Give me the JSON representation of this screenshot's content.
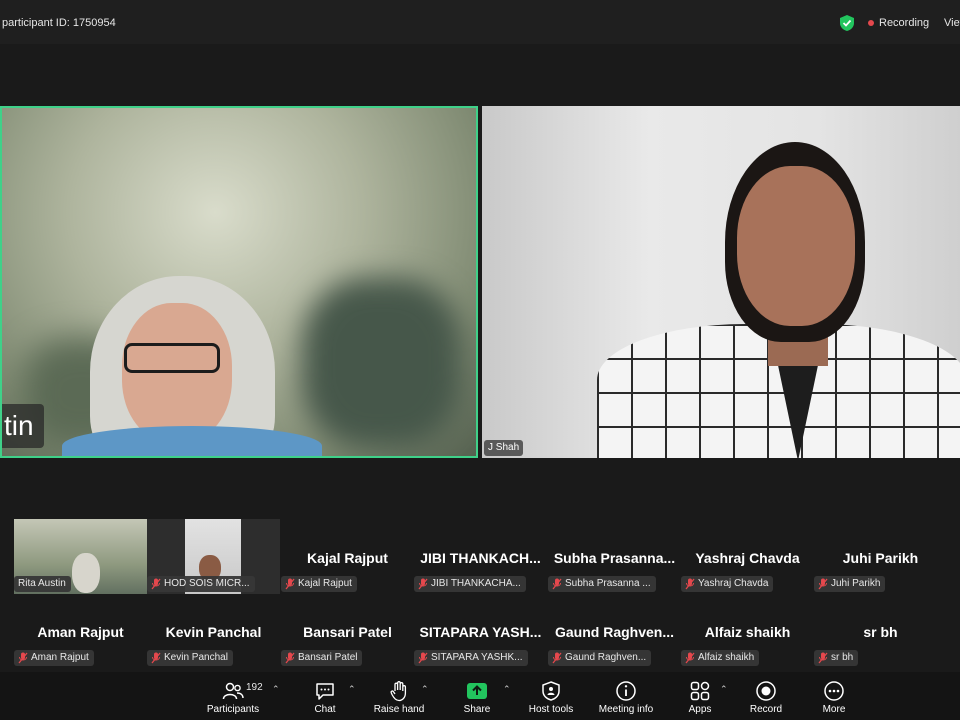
{
  "topbar": {
    "participant_id": "participant ID: 1750954",
    "recording": "Recording",
    "view": "View"
  },
  "videos": [
    {
      "name": "tin"
    },
    {
      "name": "J Shah"
    }
  ],
  "gallery_row1": [
    {
      "big": "",
      "label": "Rita Austin",
      "video": true
    },
    {
      "big": "",
      "label": "HOD SOIS MICR...",
      "video": true
    },
    {
      "big": "Kajal Rajput",
      "label": "Kajal Rajput"
    },
    {
      "big": "JIBI  THANKACH...",
      "label": "JIBI THANKACHA..."
    },
    {
      "big": "Subha  Prasanna...",
      "label": "Subha Prasanna ..."
    },
    {
      "big": "Yashraj Chavda",
      "label": "Yashraj Chavda"
    },
    {
      "big": "Juhi Parikh",
      "label": "Juhi Parikh"
    }
  ],
  "gallery_row2": [
    {
      "big": "Aman Rajput",
      "label": "Aman Rajput"
    },
    {
      "big": "Kevin Panchal",
      "label": "Kevin Panchal"
    },
    {
      "big": "Bansari Patel",
      "label": "Bansari Patel"
    },
    {
      "big": "SITAPARA  YASH...",
      "label": "SITAPARA YASHK..."
    },
    {
      "big": "Gaund  Raghven...",
      "label": "Gaund Raghven..."
    },
    {
      "big": "Alfaiz shaikh",
      "label": "Alfaiz shaikh"
    },
    {
      "big": "sr bh",
      "label": "sr bh"
    }
  ],
  "toolbar": {
    "participant_count": "192",
    "items": [
      {
        "label": "Participants",
        "icon": "participants-icon"
      },
      {
        "label": "Chat",
        "icon": "chat-icon"
      },
      {
        "label": "Raise hand",
        "icon": "raise-hand-icon"
      },
      {
        "label": "Share",
        "icon": "share-icon"
      },
      {
        "label": "Host tools",
        "icon": "host-tools-icon"
      },
      {
        "label": "Meeting info",
        "icon": "meeting-info-icon"
      },
      {
        "label": "Apps",
        "icon": "apps-icon"
      },
      {
        "label": "Record",
        "icon": "record-icon"
      },
      {
        "label": "More",
        "icon": "more-icon"
      }
    ]
  },
  "colors": {
    "active_speaker_border": "#3fd189",
    "share_green": "#22c55e",
    "recording_dot": "#e5484d",
    "muted_mic": "#e5484d"
  }
}
